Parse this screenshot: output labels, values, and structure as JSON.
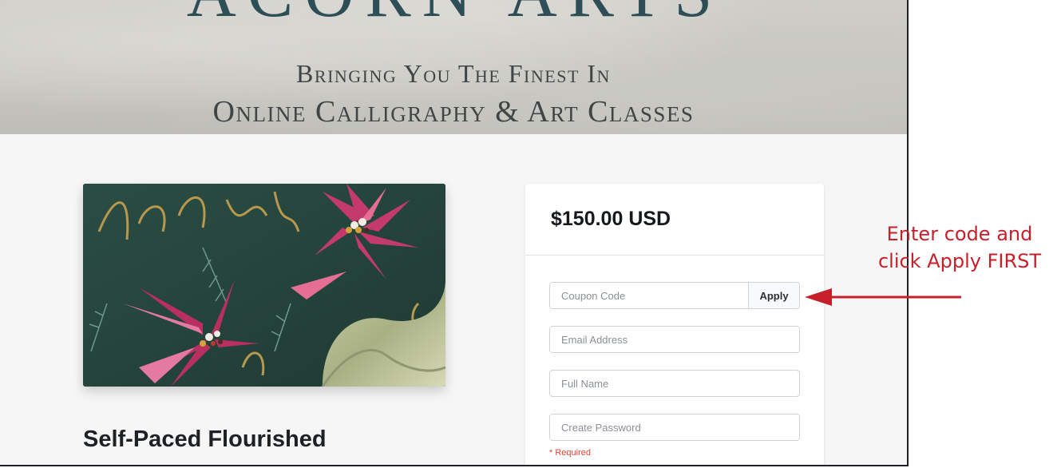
{
  "hero": {
    "logo_text": "ACORN ARTS",
    "tagline_line1": "Bringing You The Finest In",
    "tagline_line2": "Online Calligraphy & Art Classes"
  },
  "product": {
    "title": "Self-Paced Flourished"
  },
  "checkout": {
    "price": "$150.00 USD",
    "coupon_placeholder": "Coupon Code",
    "apply_label": "Apply",
    "email_placeholder": "Email Address",
    "name_placeholder": "Full Name",
    "password_placeholder": "Create Password",
    "required_note": "* Required"
  },
  "annotation": {
    "line1": "Enter code and",
    "line2": "click Apply FIRST",
    "color": "#c8202a"
  }
}
